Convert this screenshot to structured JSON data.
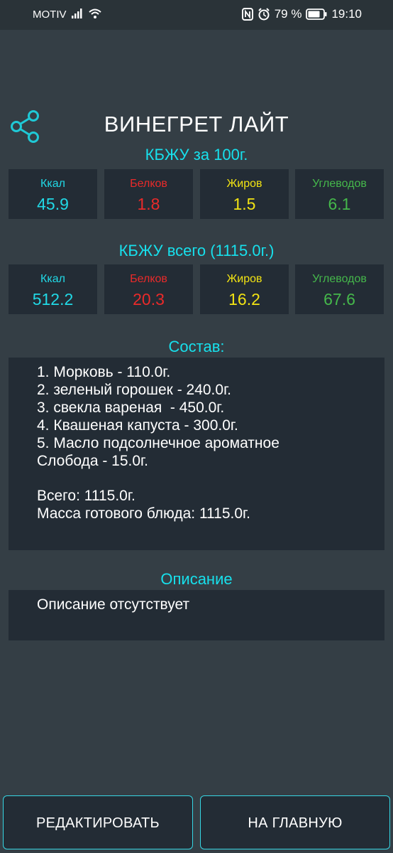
{
  "status": {
    "carrier": "MOTIV",
    "battery": "79 %",
    "time": "19:10"
  },
  "colors": {
    "kcal": "#21d9e6",
    "protein": "#ea2a2a",
    "fat": "#f2e313",
    "carbs": "#45b84b",
    "accent": "#17e0ec"
  },
  "recipe": {
    "title": "ВИНЕГРЕТ ЛАЙТ",
    "per100_heading": "КБЖУ за 100г.",
    "per100": [
      {
        "label": "Ккал",
        "value": "45.9"
      },
      {
        "label": "Белков",
        "value": "1.8"
      },
      {
        "label": "Жиров",
        "value": "1.5"
      },
      {
        "label": "Углеводов",
        "value": "6.1"
      }
    ],
    "total_heading": "КБЖУ всего (1115.0г.)",
    "total": [
      {
        "label": "Ккал",
        "value": "512.2"
      },
      {
        "label": "Белков",
        "value": "20.3"
      },
      {
        "label": "Жиров",
        "value": "16.2"
      },
      {
        "label": "Углеводов",
        "value": "67.6"
      }
    ],
    "composition_heading": "Состав:",
    "composition_lines": [
      "1. Морковь - 110.0г.",
      "2. зеленый горошек - 240.0г.",
      "3. свекла вареная  - 450.0г.",
      "4. Квашеная капуста - 300.0г.",
      "5. Масло подсолнечное ароматное",
      "Слобода - 15.0г.",
      "Всего: 1115.0г.",
      "Масса готового блюда: 1115.0г."
    ],
    "description_heading": "Описание",
    "description_text": "Описание отсутствует"
  },
  "buttons": {
    "edit": "РЕДАКТИРОВАТЬ",
    "home": "НА ГЛАВНУЮ"
  }
}
